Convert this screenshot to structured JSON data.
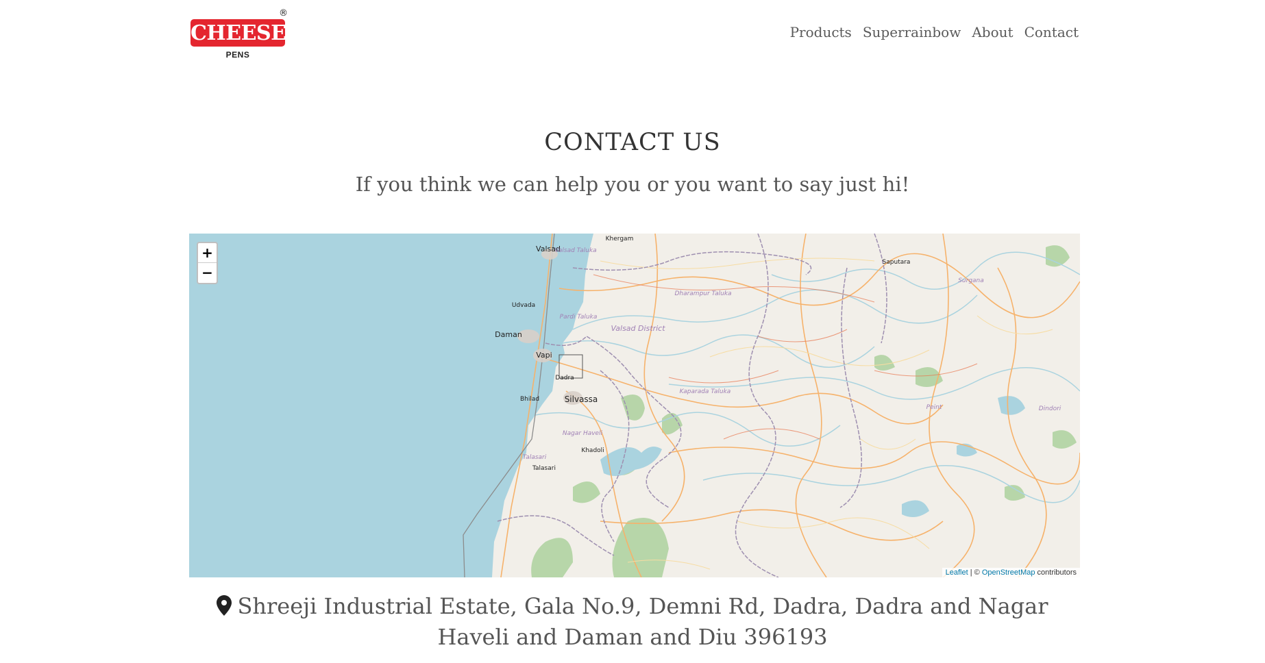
{
  "logo": {
    "brand": "CHEESE",
    "sub": "PENS",
    "reg": "®",
    "color": "#e4262f"
  },
  "nav": [
    "Products",
    "Superrainbow",
    "About",
    "Contact"
  ],
  "page": {
    "title": "CONTACT US",
    "subtitle": "If you think we can help you or you want to say just hi!"
  },
  "map": {
    "zoom_in": "+",
    "zoom_out": "−",
    "attribution_link": "Leaflet",
    "attribution_sep": " | © ",
    "attribution_osm": "OpenStreetMap",
    "attribution_tail": " contributors",
    "labels": {
      "valsad": "Valsad",
      "valsad_taluka": "Valsad Taluka",
      "khergam": "Khergam",
      "saputara": "Saputara",
      "surgana": "Surgana",
      "dharampur": "Dharampur Taluka",
      "udvada": "Udvada",
      "pardi": "Pardi Taluka",
      "valsad_district": "Valsad District",
      "daman": "Daman",
      "vapi": "Vapi",
      "dadra": "Dadra",
      "bhilad": "Bhilad",
      "silvassa": "Silvassa",
      "kaparada": "Kaparada Taluka",
      "peint": "Peint",
      "dindori": "Dindori",
      "nagar_haveli": "Nagar Haveli",
      "khadoli": "Khadoli",
      "talasari_taluka": "Talasari",
      "talasari": "Talasari"
    },
    "colors": {
      "sea": "#aad3df",
      "land": "#f2efe9",
      "road": "#f6b26b",
      "border": "#9e8fb0",
      "forest": "#add19e"
    }
  },
  "address": {
    "icon": "map-marker-icon",
    "text": "Shreeji Industrial Estate, Gala No.9, Demni Rd, Dadra, Dadra and Nagar Haveli and Daman and Diu 396193"
  }
}
